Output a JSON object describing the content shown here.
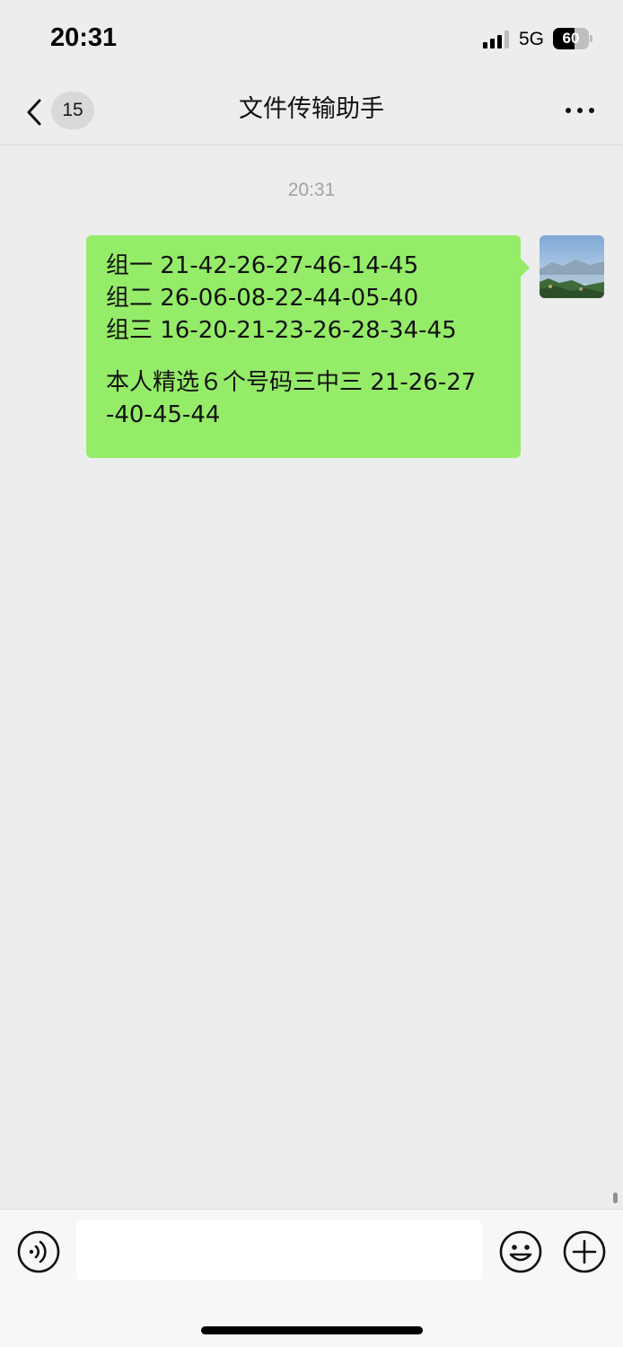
{
  "status_bar": {
    "time": "20:31",
    "network": "5G",
    "battery_level": "60",
    "battery_fraction": 0.6,
    "signal_bars_active": 3,
    "signal_bars_total": 4
  },
  "nav": {
    "unread_count": "15",
    "title": "文件传输助手"
  },
  "chat": {
    "timestamp": "20:31",
    "message": {
      "lines": [
        "组一 21-42-26-27-46-14-45",
        "组二 26-06-08-22-44-05-40",
        "组三 16-20-21-23-26-28-34-45",
        "",
        "本人精选６个号码三中三 21-26-27",
        "-40-45-44"
      ],
      "bubble_color": "#95ec69"
    }
  },
  "input_bar": {
    "text_value": "",
    "placeholder": ""
  },
  "colors": {
    "background": "#ededed",
    "bubble": "#95ec69",
    "input_bar": "#f7f7f7"
  }
}
